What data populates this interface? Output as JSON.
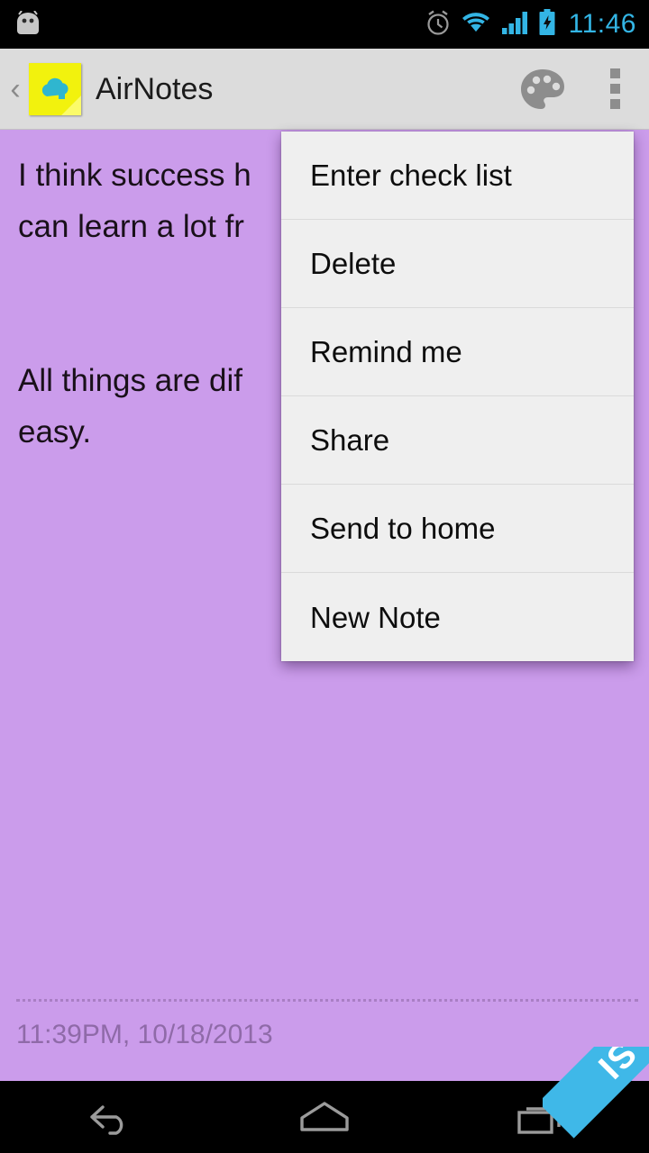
{
  "status_bar": {
    "notification_icon": "android-robot-icon",
    "icons": [
      "alarm-clock-icon",
      "wifi-icon",
      "cellular-signal-icon",
      "battery-charging-icon"
    ],
    "clock": "11:46",
    "accent_color": "#33b5e5",
    "background_color": "#000000"
  },
  "action_bar": {
    "up_chevron": "‹",
    "app_icon": "sticky-note-cloud-icon",
    "title": "AirNotes",
    "palette_label": "palette-icon",
    "overflow_label": "overflow-menu-icon",
    "background_color": "#dcdcdc"
  },
  "note": {
    "body": "I think success h\ncan learn a lot fr\n\n\nAll things are dif\neasy.",
    "full_text_visible": "I think success h can learn a lot fr All things are dif easy.",
    "timestamp": "11:39PM, 10/18/2013",
    "background_color": "#cb9ceb",
    "text_color": "#191019",
    "timestamp_color": "#8f6aa8"
  },
  "popup_menu": {
    "background_color": "#efefef",
    "items": [
      {
        "label": "Enter check list",
        "name": "menu-item-enter-check-list"
      },
      {
        "label": "Delete",
        "name": "menu-item-delete"
      },
      {
        "label": "Remind me",
        "name": "menu-item-remind-me"
      },
      {
        "label": "Share",
        "name": "menu-item-share"
      },
      {
        "label": "Send to home",
        "name": "menu-item-send-to-home"
      },
      {
        "label": "New Note",
        "name": "menu-item-new-note"
      }
    ]
  },
  "nav_bar": {
    "buttons": [
      "back-icon",
      "home-icon",
      "recents-icon"
    ],
    "background_color": "#000000"
  },
  "corner_ribbon": {
    "text": "SI",
    "color": "#3fb8e8"
  }
}
